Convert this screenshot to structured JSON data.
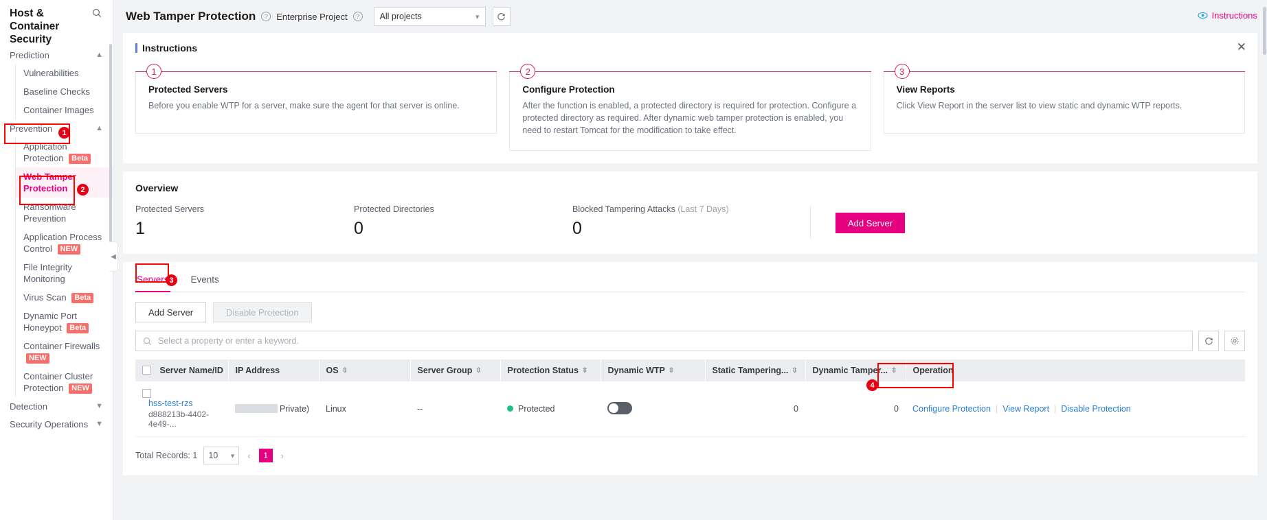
{
  "sidebar": {
    "title": "Host & Container Security",
    "search_icon": "search-icon",
    "groups": [
      {
        "label": "Prediction",
        "expanded": true
      },
      {
        "label": "Prevention",
        "expanded": true
      },
      {
        "label": "Detection",
        "expanded": false
      },
      {
        "label": "Security Operations",
        "expanded": false
      }
    ],
    "prediction_items": [
      {
        "label": "Vulnerabilities"
      },
      {
        "label": "Baseline Checks"
      },
      {
        "label": "Container Images"
      }
    ],
    "prevention_items": [
      {
        "label": "Application Protection",
        "badge": "Beta"
      },
      {
        "label": "Web Tamper Protection",
        "badge": "",
        "active": true
      },
      {
        "label": "Ransomware Prevention",
        "badge": ""
      },
      {
        "label": "Application Process Control",
        "badge": "NEW"
      },
      {
        "label": "File Integrity Monitoring",
        "badge": ""
      },
      {
        "label": "Virus Scan",
        "badge": "Beta"
      },
      {
        "label": "Dynamic Port Honeypot",
        "badge": "Beta"
      },
      {
        "label": "Container Firewalls",
        "badge": "NEW"
      },
      {
        "label": "Container Cluster Protection",
        "badge": "NEW"
      }
    ]
  },
  "header": {
    "title": "Web Tamper Protection",
    "title_help": "?",
    "enterprise_project_label": "Enterprise Project",
    "enterprise_project_help": "?",
    "project_selected": "All projects",
    "refresh_icon": "refresh-icon",
    "instructions_link": "Instructions",
    "instructions_eye_icon": "eye-icon"
  },
  "instructions": {
    "title": "Instructions",
    "close_icon": "close-icon",
    "steps": [
      {
        "number": "1",
        "heading": "Protected Servers",
        "text": "Before you enable WTP for a server, make sure the agent for that server is online."
      },
      {
        "number": "2",
        "heading": "Configure Protection",
        "text": "After the function is enabled, a protected directory is required for protection. Configure a protected directory as required. After dynamic web tamper protection is enabled, you need to restart Tomcat for the modification to take effect."
      },
      {
        "number": "3",
        "heading": "View Reports",
        "text": "Click View Report in the server list to view static and dynamic WTP reports."
      }
    ]
  },
  "overview": {
    "title": "Overview",
    "stats": [
      {
        "label": "Protected Servers",
        "sub": "",
        "value": "1"
      },
      {
        "label": "Protected Directories",
        "sub": "",
        "value": "0"
      },
      {
        "label": "Blocked Tampering Attacks",
        "sub": "(Last 7 Days)",
        "value": "0"
      }
    ],
    "add_server_button": "Add Server"
  },
  "table_section": {
    "tabs": [
      {
        "label": "Servers",
        "active": true
      },
      {
        "label": "Events",
        "active": false
      }
    ],
    "toolbar": {
      "add_server": "Add Server",
      "disable_protection": "Disable Protection"
    },
    "search": {
      "placeholder": "Select a property or enter a keyword.",
      "search_icon": "search-icon",
      "refresh_icon": "refresh-icon",
      "settings_icon": "gear-icon"
    },
    "columns": [
      {
        "label": "Server Name/ID",
        "sortable": true
      },
      {
        "label": "IP Address",
        "sortable": false
      },
      {
        "label": "OS",
        "sortable": true
      },
      {
        "label": "Server Group",
        "sortable": true
      },
      {
        "label": "Protection Status",
        "sortable": true
      },
      {
        "label": "Dynamic WTP",
        "sortable": true
      },
      {
        "label": "Static Tampering...",
        "sortable": true
      },
      {
        "label": "Dynamic Tamper...",
        "sortable": true
      },
      {
        "label": "Operation",
        "sortable": false
      }
    ],
    "rows": [
      {
        "server_name": "hss-test-rzs",
        "server_id": "d888213b-4402-4e49-...",
        "ip_address": "Private)",
        "os": "Linux",
        "server_group": "--",
        "protection_status": "Protected",
        "dynamic_wtp": "off",
        "static_tampering": "0",
        "dynamic_tampering": "0",
        "operations": [
          "Configure Protection",
          "View Report",
          "Disable Protection"
        ]
      }
    ],
    "pagination": {
      "total_label": "Total Records: 1",
      "page_size": "10",
      "prev": "‹",
      "current_page": "1",
      "next": "›"
    }
  },
  "annotations": [
    {
      "number": "1"
    },
    {
      "number": "2"
    },
    {
      "number": "3"
    },
    {
      "number": "4"
    }
  ],
  "colors": {
    "accent_pink": "#e60080",
    "annotation_red": "#e60012",
    "link_blue": "#2b7fd6",
    "status_green": "#19bf8c",
    "badge_red": "#f66f6a"
  }
}
